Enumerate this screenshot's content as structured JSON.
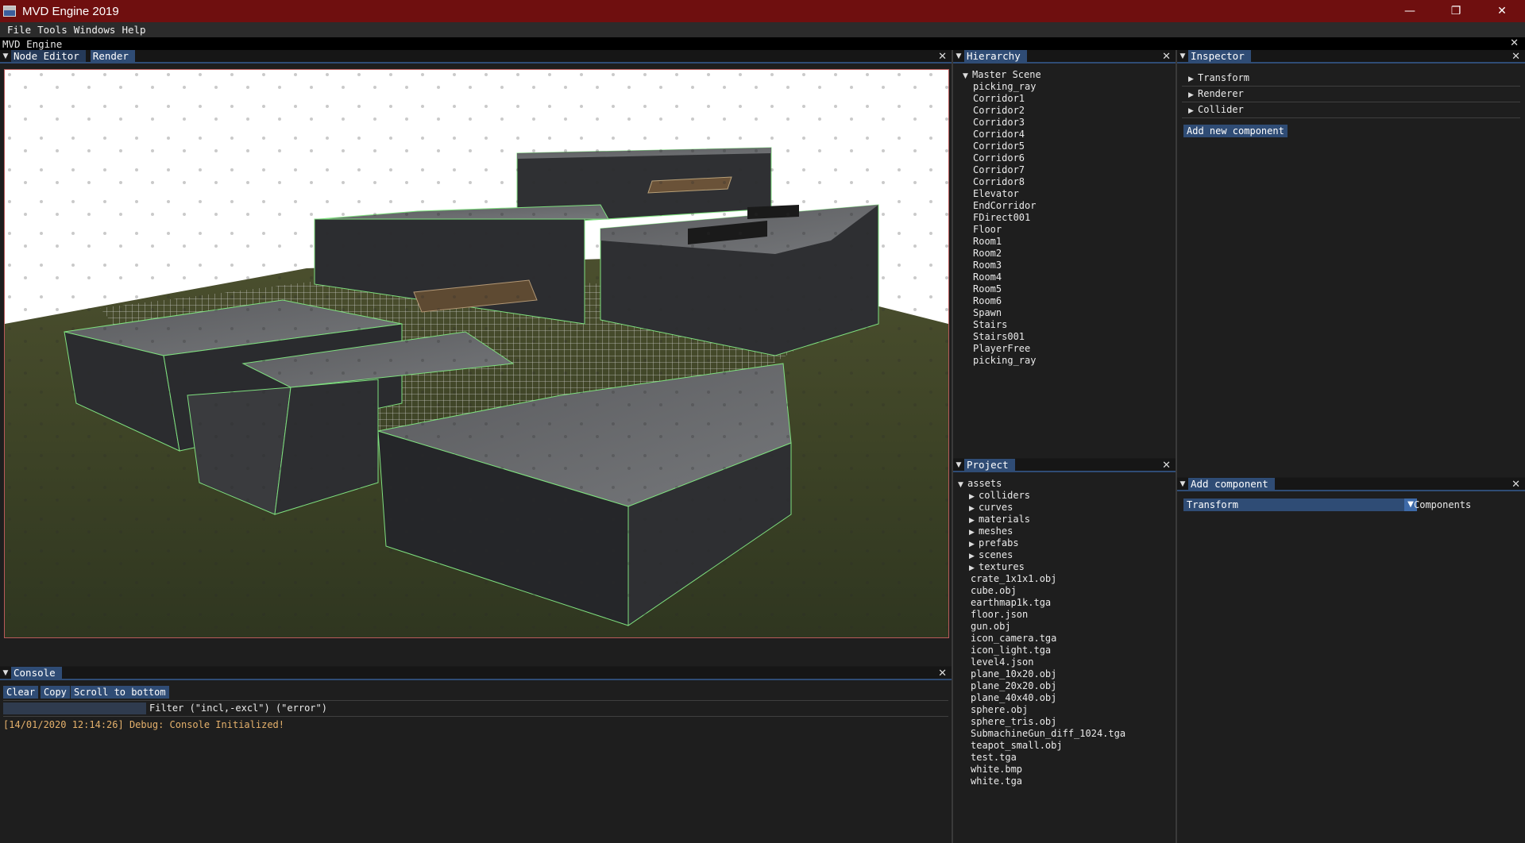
{
  "window": {
    "title": "MVD Engine 2019",
    "controls": {
      "minimize": "—",
      "restore": "❐",
      "close": "✕"
    }
  },
  "menu": {
    "items": [
      "File",
      "Tools",
      "Windows",
      "Help"
    ]
  },
  "engine_strip": {
    "label": "MVD Engine",
    "close": "✕"
  },
  "render_panel": {
    "tabs": [
      "Node Editor",
      "Render"
    ],
    "active_tab": "Render",
    "close": "✕"
  },
  "console": {
    "tab": "Console",
    "close": "✕",
    "buttons": {
      "clear": "Clear",
      "copy": "Copy",
      "scroll": "Scroll to bottom"
    },
    "filter_label": "Filter (\"incl,-excl\") (\"error\")",
    "log": [
      "[14/01/2020 12:14:26] Debug: Console Initialized!"
    ],
    "log_color": "#e5b16c"
  },
  "hierarchy": {
    "tab": "Hierarchy",
    "close": "✕",
    "root": "Master Scene",
    "items": [
      "picking_ray",
      "Corridor1",
      "Corridor2",
      "Corridor3",
      "Corridor4",
      "Corridor5",
      "Corridor6",
      "Corridor7",
      "Corridor8",
      "Elevator",
      "EndCorridor",
      "FDirect001",
      "Floor",
      "Room1",
      "Room2",
      "Room3",
      "Room4",
      "Room5",
      "Room6",
      "Spawn",
      "Stairs",
      "Stairs001",
      "PlayerFree",
      "picking_ray"
    ]
  },
  "project": {
    "tab": "Project",
    "close": "✕",
    "root": "assets",
    "folders": [
      "colliders",
      "curves",
      "materials",
      "meshes",
      "prefabs",
      "scenes",
      "textures"
    ],
    "files": [
      "crate_1x1x1.obj",
      "cube.obj",
      "earthmap1k.tga",
      "floor.json",
      "gun.obj",
      "icon_camera.tga",
      "icon_light.tga",
      "level4.json",
      "plane_10x20.obj",
      "plane_20x20.obj",
      "plane_40x40.obj",
      "sphere.obj",
      "sphere_tris.obj",
      "SubmachineGun_diff_1024.tga",
      "teapot_small.obj",
      "test.tga",
      "white.bmp",
      "white.tga"
    ]
  },
  "inspector": {
    "tab": "Inspector",
    "close": "✕",
    "components": [
      "Transform",
      "Renderer",
      "Collider"
    ],
    "add_button": "Add new component"
  },
  "add_component": {
    "tab": "Add component",
    "close": "✕",
    "selected": "Transform",
    "label": "Components"
  },
  "colors": {
    "title_bar": "#6f0f0f",
    "accent": "#2f4c75",
    "panel_bg": "#1e1e1e"
  }
}
